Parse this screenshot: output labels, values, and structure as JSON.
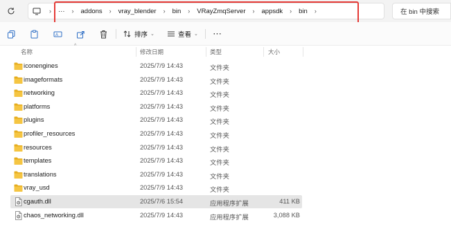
{
  "breadcrumbs": {
    "ellipsis": "···",
    "items": [
      "addons",
      "vray_blender",
      "bin",
      "VRayZmqServer",
      "appsdk",
      "bin"
    ],
    "separator": "›"
  },
  "search": {
    "placeholder": "在 bin 中搜索"
  },
  "toolbar": {
    "sort_label": "排序",
    "view_label": "查看",
    "more_label": "···"
  },
  "columns": {
    "name": "名称",
    "date": "修改日期",
    "type": "类型",
    "size": "大小"
  },
  "files": [
    {
      "name": "iconengines",
      "date": "2025/7/9 14:43",
      "type": "文件夹",
      "size": "",
      "kind": "folder"
    },
    {
      "name": "imageformats",
      "date": "2025/7/9 14:43",
      "type": "文件夹",
      "size": "",
      "kind": "folder"
    },
    {
      "name": "networking",
      "date": "2025/7/9 14:43",
      "type": "文件夹",
      "size": "",
      "kind": "folder"
    },
    {
      "name": "platforms",
      "date": "2025/7/9 14:43",
      "type": "文件夹",
      "size": "",
      "kind": "folder"
    },
    {
      "name": "plugins",
      "date": "2025/7/9 14:43",
      "type": "文件夹",
      "size": "",
      "kind": "folder"
    },
    {
      "name": "profiler_resources",
      "date": "2025/7/9 14:43",
      "type": "文件夹",
      "size": "",
      "kind": "folder"
    },
    {
      "name": "resources",
      "date": "2025/7/9 14:43",
      "type": "文件夹",
      "size": "",
      "kind": "folder"
    },
    {
      "name": "templates",
      "date": "2025/7/9 14:43",
      "type": "文件夹",
      "size": "",
      "kind": "folder"
    },
    {
      "name": "translations",
      "date": "2025/7/9 14:43",
      "type": "文件夹",
      "size": "",
      "kind": "folder"
    },
    {
      "name": "vray_usd",
      "date": "2025/7/9 14:43",
      "type": "文件夹",
      "size": "",
      "kind": "folder"
    },
    {
      "name": "cgauth.dll",
      "date": "2025/7/6 15:54",
      "type": "应用程序扩展",
      "size": "411 KB",
      "kind": "dll",
      "selected": true
    },
    {
      "name": "chaos_networking.dll",
      "date": "2025/7/9 14:43",
      "type": "应用程序扩展",
      "size": "3,088 KB",
      "kind": "dll"
    }
  ],
  "colors": {
    "folder": "#f5c542",
    "folder_dark": "#e6ad1e",
    "highlight_box": "#e53935",
    "selected_row": "#e5e5e5"
  }
}
